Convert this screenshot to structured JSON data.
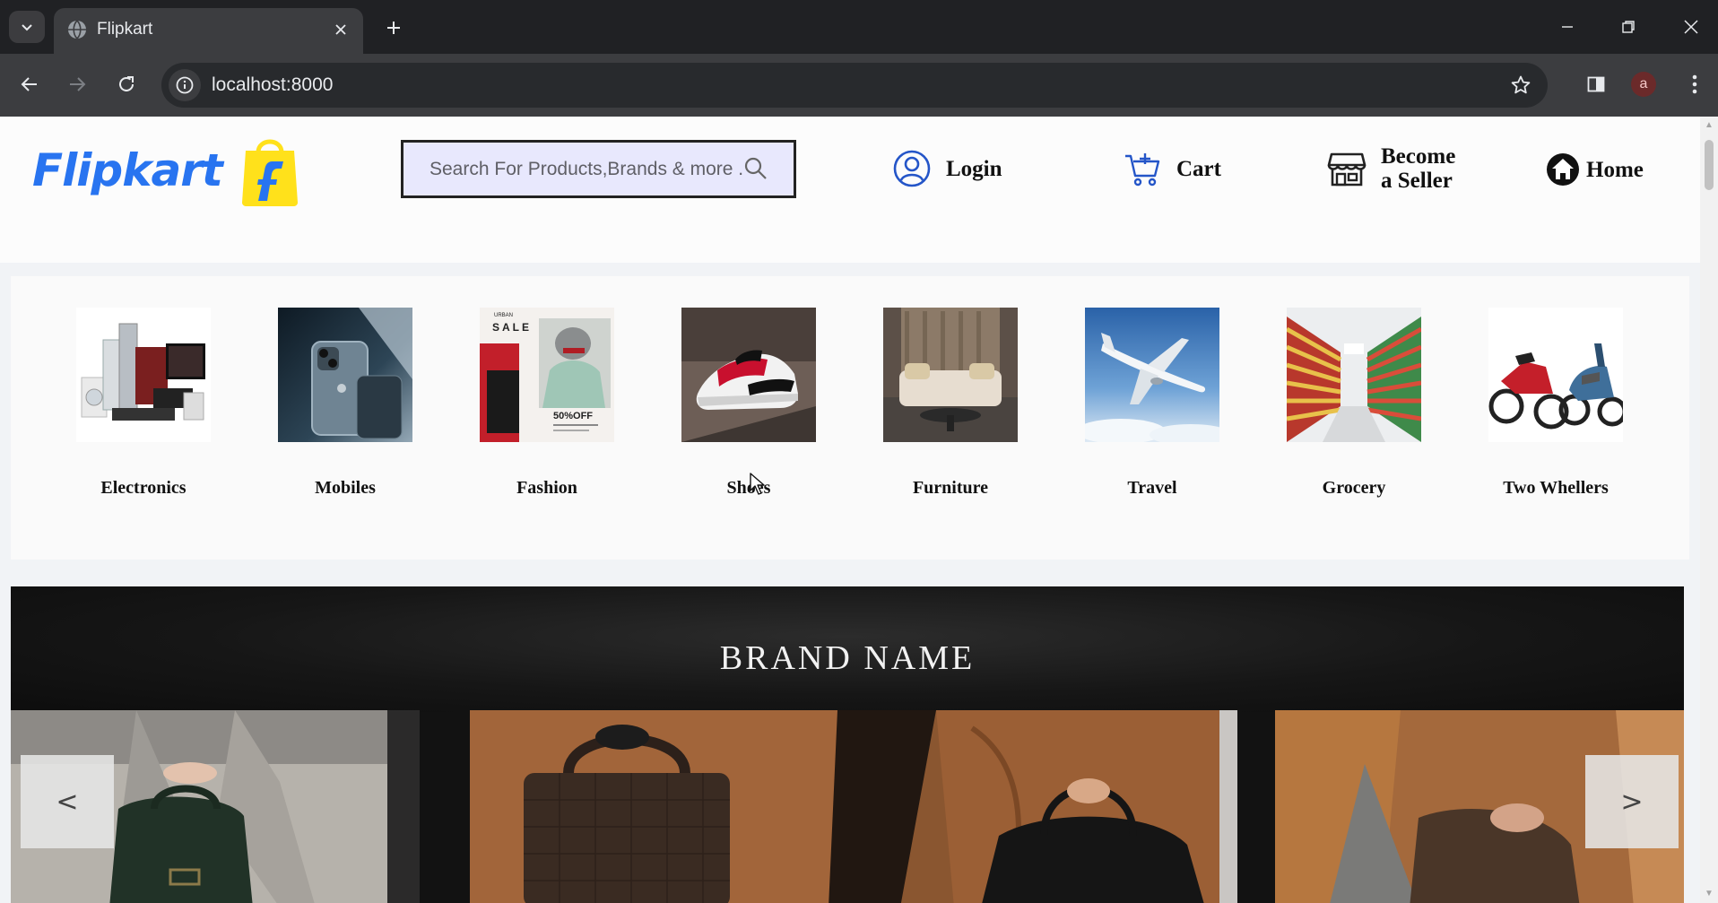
{
  "browser": {
    "tab_title": "Flipkart",
    "url": "localhost:8000",
    "profile_initial": "a"
  },
  "header": {
    "logo_text": "Flipkart",
    "search_placeholder": "Search For Products,Brands & more ..",
    "login_label": "Login",
    "cart_label": "Cart",
    "seller_label_line1": "Become",
    "seller_label_line2": "a Seller",
    "home_label": "Home"
  },
  "categories": [
    {
      "label": "Electronics"
    },
    {
      "label": "Mobiles"
    },
    {
      "label": "Fashion"
    },
    {
      "label": "Shoes"
    },
    {
      "label": "Furniture"
    },
    {
      "label": "Travel"
    },
    {
      "label": "Grocery"
    },
    {
      "label": "Two Whellers"
    }
  ],
  "fashion_image_text": {
    "line1": "URBAN",
    "line2": "SALE",
    "discount": "50%OFF"
  },
  "banner": {
    "title": "BRAND NAME",
    "prev_label": "<",
    "next_label": ">"
  },
  "colors": {
    "brand_blue": "#2874f0",
    "logo_yellow": "#ffe11b",
    "search_bg": "#e8e8fd",
    "banner_bg": "#121212"
  }
}
